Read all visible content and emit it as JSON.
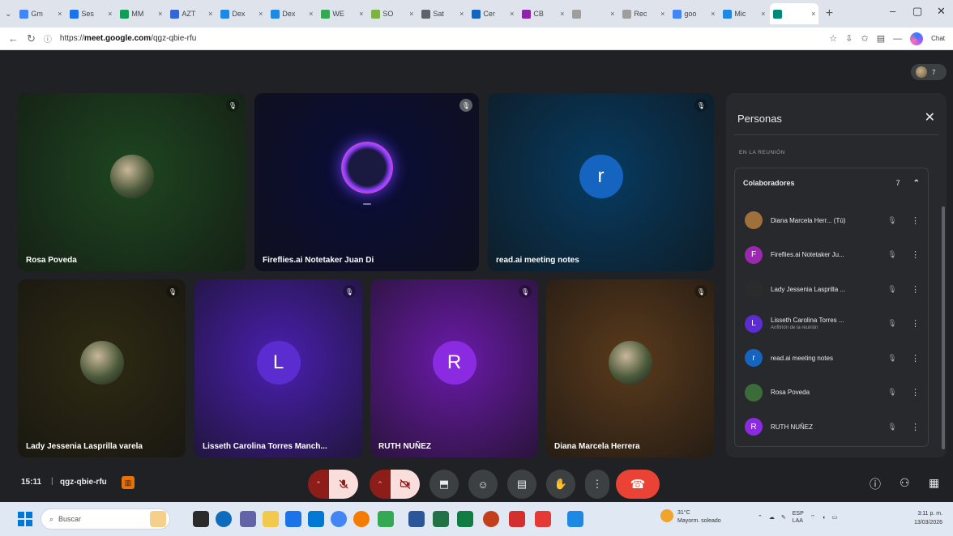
{
  "browser": {
    "tabs": [
      {
        "label": "Gm",
        "color": "#4285f4"
      },
      {
        "label": "Ses",
        "color": "#1a73e8"
      },
      {
        "label": "MM",
        "color": "#0f9d58"
      },
      {
        "label": "AZT",
        "color": "#3367d6"
      },
      {
        "label": "Dex",
        "color": "#1e88e5"
      },
      {
        "label": "Dex",
        "color": "#1e88e5"
      },
      {
        "label": "WE",
        "color": "#34a853"
      },
      {
        "label": "SO",
        "color": "#7cb342"
      },
      {
        "label": "Sat",
        "color": "#5f6368"
      },
      {
        "label": "Cer",
        "color": "#1565c0"
      },
      {
        "label": "CB",
        "color": "#8e24aa"
      },
      {
        "label": "",
        "color": "#9e9e9e"
      },
      {
        "label": "Rec",
        "color": "#9e9e9e"
      },
      {
        "label": "goo",
        "color": "#4285f4"
      },
      {
        "label": "Mic",
        "color": "#1e88e5"
      },
      {
        "label": "",
        "color": "#00897b",
        "active": true
      }
    ],
    "url_prefix": "https://",
    "url_host": "meet.google.com",
    "url_path": "/qgz-qbie-rfu",
    "copilot_label": "Chat"
  },
  "tiles": [
    {
      "name": "Rosa Poveda",
      "kind": "photo",
      "bg": "#1e4620"
    },
    {
      "name": "Fireflies.ai Notetaker Juan Di",
      "kind": "fireflies",
      "bg": "#0a0d3a"
    },
    {
      "name": "read.ai meeting notes",
      "kind": "letter",
      "letter": "r",
      "bg": "#073b61",
      "avatar_color": "#1565c0"
    },
    {
      "name": "Lady Jessenia Lasprilla varela",
      "kind": "photo",
      "bg": "#2e2a12"
    },
    {
      "name": "Lisseth Carolina Torres Manch...",
      "kind": "letter",
      "letter": "L",
      "bg": "#4a1fb0",
      "avatar_color": "#5b2ccf"
    },
    {
      "name": "RUTH NUÑEZ",
      "kind": "letter",
      "letter": "R",
      "bg": "#6a1aa8",
      "avatar_color": "#8a2be2"
    },
    {
      "name": "Diana Marcela Herrera",
      "kind": "photo",
      "bg": "#5a3a1c"
    }
  ],
  "topright_count": "7",
  "panel": {
    "title": "Personas",
    "section_label": "EN LA REUNIÓN",
    "group_title": "Colaboradores",
    "group_count": "7",
    "people": [
      {
        "name": "Diana Marcela Herr... (Tú)",
        "sub": "",
        "letter": "",
        "color": "#a0703a"
      },
      {
        "name": "Fireflies.ai Notetaker Ju...",
        "sub": "",
        "letter": "F",
        "color": "#9c27b0"
      },
      {
        "name": "Lady Jessenia Lasprilla ...",
        "sub": "",
        "letter": "",
        "color": "#2b2b2b"
      },
      {
        "name": "Lisseth Carolina Torres ...",
        "sub": "Anfitrión de la reunión",
        "letter": "L",
        "color": "#5b2ccf"
      },
      {
        "name": "read.ai meeting notes",
        "sub": "",
        "letter": "r",
        "color": "#1565c0"
      },
      {
        "name": "Rosa Poveda",
        "sub": "",
        "letter": "",
        "color": "#3c6b3a"
      },
      {
        "name": "RUTH NUÑEZ",
        "sub": "",
        "letter": "R",
        "color": "#8a2be2"
      }
    ]
  },
  "bottom": {
    "time": "15:11",
    "separator": "|",
    "code": "qgz-qbie-rfu"
  },
  "taskbar": {
    "search_placeholder": "Buscar",
    "weather_temp": "31°C",
    "weather_desc": "Mayorm. soleado",
    "lang1": "ESP",
    "lang2": "LAA",
    "time": "3:11 p. m.",
    "date": "13/03/2026"
  }
}
